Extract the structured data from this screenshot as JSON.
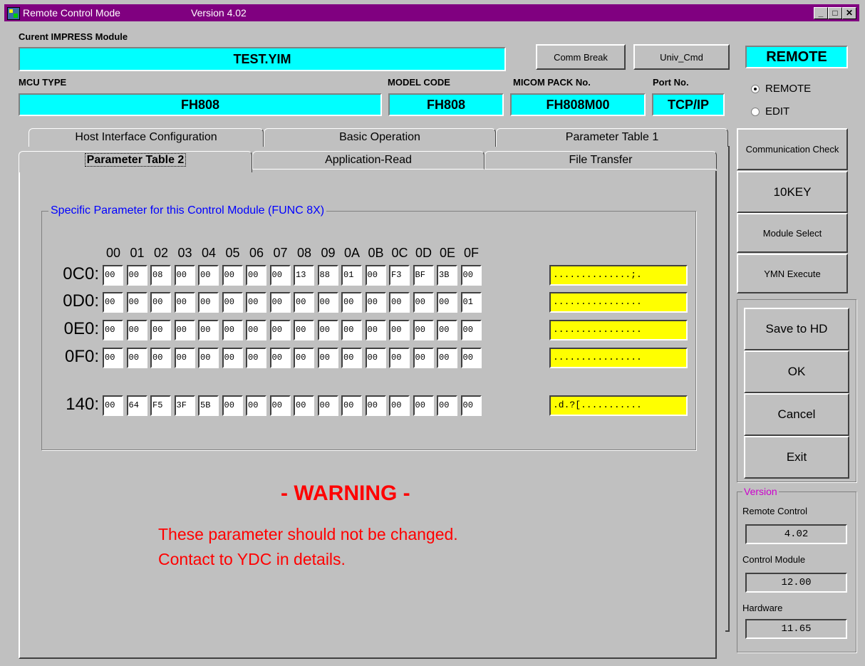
{
  "window": {
    "title": "Remote Control Mode",
    "version": "Version  4.02"
  },
  "module": {
    "label": "Curent IMPRESS Module",
    "value": "TEST.YIM",
    "comm_break": "Comm Break",
    "univ_cmd": "Univ_Cmd",
    "mode_display": "REMOTE"
  },
  "mcu": {
    "mcu_type_label": "MCU TYPE",
    "mcu_type": "FH808",
    "model_code_label": "MODEL CODE",
    "model_code": "FH808",
    "micom_pack_label": "MICOM PACK No.",
    "micom_pack": "FH808M00",
    "port_label": "Port No.",
    "port": "TCP/IP"
  },
  "mode": {
    "remote": "REMOTE",
    "edit": "EDIT",
    "selected": "REMOTE"
  },
  "tabs": {
    "row1": [
      "Host Interface Configuration",
      "Basic Operation",
      "Parameter Table 1"
    ],
    "row2": [
      "Parameter Table 2",
      "Application-Read",
      "File Transfer"
    ],
    "active": "Parameter Table 2"
  },
  "group_title": "Specific Parameter for this Control Module (FUNC 8X)",
  "hex": {
    "columns": [
      "00",
      "01",
      "02",
      "03",
      "04",
      "05",
      "06",
      "07",
      "08",
      "09",
      "0A",
      "0B",
      "0C",
      "0D",
      "0E",
      "0F"
    ],
    "rows": [
      {
        "addr": "0C0:",
        "bytes": [
          "00",
          "00",
          "08",
          "00",
          "00",
          "00",
          "00",
          "00",
          "13",
          "88",
          "01",
          "00",
          "F3",
          "BF",
          "3B",
          "00"
        ],
        "ascii": "..............;."
      },
      {
        "addr": "0D0:",
        "bytes": [
          "00",
          "00",
          "00",
          "00",
          "00",
          "00",
          "00",
          "00",
          "00",
          "00",
          "00",
          "00",
          "00",
          "00",
          "00",
          "01"
        ],
        "ascii": "................"
      },
      {
        "addr": "0E0:",
        "bytes": [
          "00",
          "00",
          "00",
          "00",
          "00",
          "00",
          "00",
          "00",
          "00",
          "00",
          "00",
          "00",
          "00",
          "00",
          "00",
          "00"
        ],
        "ascii": "................"
      },
      {
        "addr": "0F0:",
        "bytes": [
          "00",
          "00",
          "00",
          "00",
          "00",
          "00",
          "00",
          "00",
          "00",
          "00",
          "00",
          "00",
          "00",
          "00",
          "00",
          "00"
        ],
        "ascii": "................"
      },
      {
        "addr": "140:",
        "bytes": [
          "00",
          "64",
          "F5",
          "3F",
          "5B",
          "00",
          "00",
          "00",
          "00",
          "00",
          "00",
          "00",
          "00",
          "00",
          "00",
          "00"
        ],
        "ascii": ".d.?[..........."
      }
    ]
  },
  "warning": {
    "title": "- WARNING -",
    "line1": "These parameter should not be changed.",
    "line2": "Contact to YDC in details."
  },
  "side_buttons": {
    "comm_check": "Communication Check",
    "tenkey": "10KEY",
    "module_select": "Module Select",
    "ymn_execute": "YMN Execute",
    "save_to_hd": "Save to HD",
    "ok": "OK",
    "cancel": "Cancel",
    "exit": "Exit"
  },
  "version_box": {
    "title": "Version",
    "remote_control_label": "Remote Control",
    "remote_control": "4.02",
    "control_module_label": "Control Module",
    "control_module": "12.00",
    "hardware_label": "Hardware",
    "hardware": "11.65"
  },
  "colors": {
    "title_bar": "#800080",
    "field": "#00ffff",
    "ascii_field": "#ffff00",
    "warning": "#ff0000",
    "group_title": "#0000ff",
    "version_title": "#cc00cc"
  }
}
